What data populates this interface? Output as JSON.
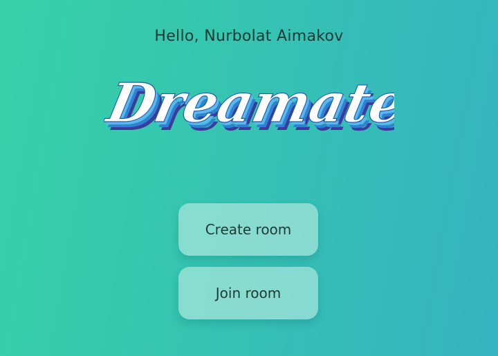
{
  "header": {
    "greeting_prefix": "Hello,",
    "user_name": "Nurbolat Aimakov"
  },
  "logo": {
    "text": "Dreamate"
  },
  "actions": {
    "create_label": "Create room",
    "join_label": "Join room"
  },
  "colors": {
    "background_start": "#37d1a8",
    "background_end": "#36b2c0",
    "logo_fill": "#ffffff",
    "logo_shadow_light": "#5ab8f0",
    "logo_shadow_mid": "#2f82cf",
    "logo_shadow_dark": "#3b3a9e"
  }
}
